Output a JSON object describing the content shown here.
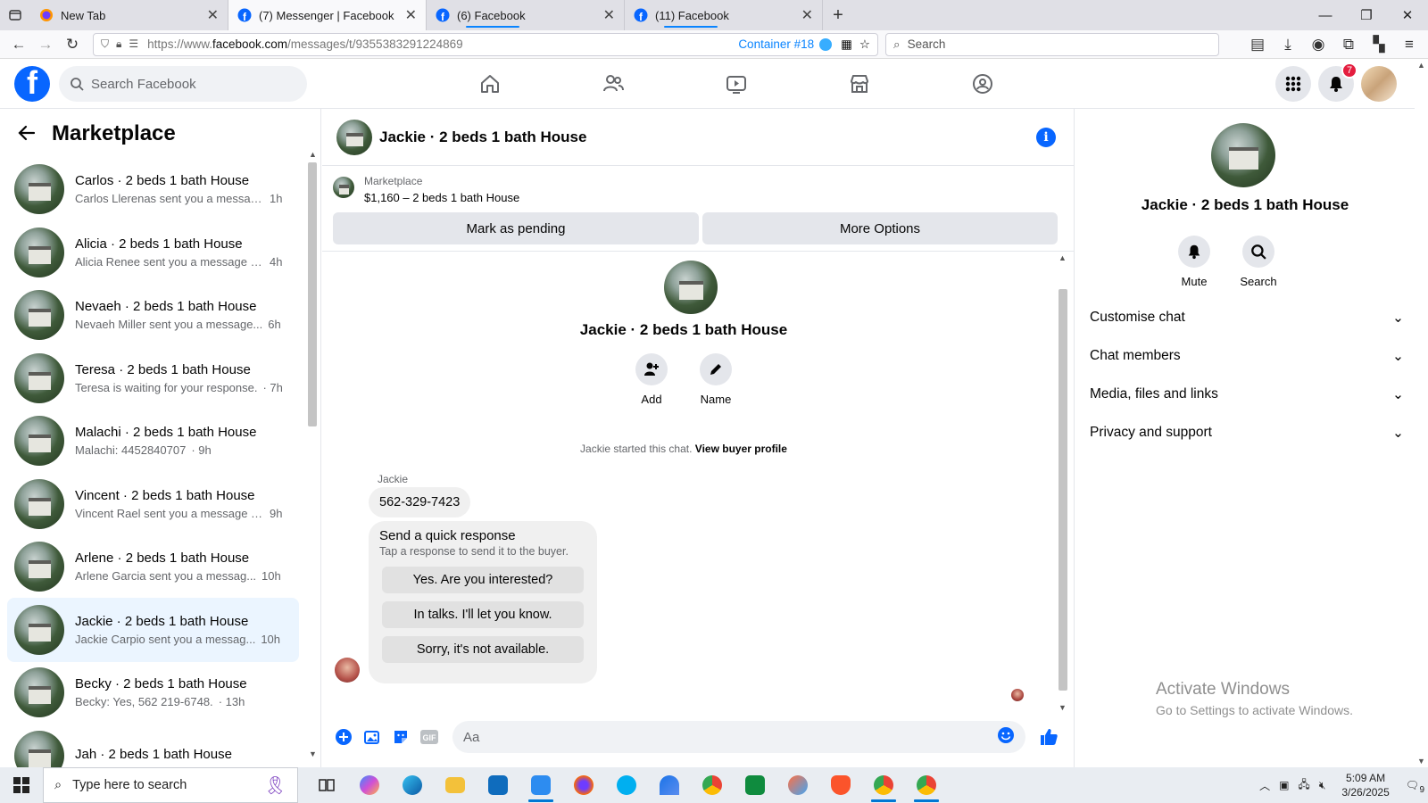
{
  "browser": {
    "tabs": [
      {
        "label": "New Tab",
        "favicon": "firefox"
      },
      {
        "label": "(7) Messenger | Facebook",
        "favicon": "facebook",
        "active": true
      },
      {
        "label": "(6) Facebook",
        "favicon": "facebook"
      },
      {
        "label": "(11) Facebook",
        "favicon": "facebook"
      }
    ],
    "url_prefix": "https://www.",
    "url_domain": "facebook.com",
    "url_path": "/messages/t/9355383291224869",
    "container_label": "Container #18",
    "search_placeholder": "Search"
  },
  "fb": {
    "search_placeholder": "Search Facebook",
    "notifications_count": "7",
    "brand_color": "#0866ff"
  },
  "sidebar": {
    "title": "Marketplace",
    "conversations": [
      {
        "name": "Carlos · 2 beds 1 bath House",
        "preview": "Carlos Llerenas sent you a messag...",
        "time": "1h"
      },
      {
        "name": "Alicia · 2 beds 1 bath House",
        "preview": "Alicia Renee sent you a message a...",
        "time": "4h"
      },
      {
        "name": "Nevaeh · 2 beds 1 bath House",
        "preview": "Nevaeh Miller sent you a message...",
        "time": "6h"
      },
      {
        "name": "Teresa · 2 beds 1 bath House",
        "preview": "Teresa is waiting for your response.",
        "time": "· 7h"
      },
      {
        "name": "Malachi · 2 beds 1 bath House",
        "preview": "Malachi: 4452840707",
        "time": "· 9h"
      },
      {
        "name": "Vincent · 2 beds 1 bath House",
        "preview": "Vincent Rael sent you a message a...",
        "time": "9h"
      },
      {
        "name": "Arlene · 2 beds 1 bath House",
        "preview": "Arlene Garcia sent you a messag...",
        "time": "10h"
      },
      {
        "name": "Jackie · 2 beds 1 bath House",
        "preview": "Jackie Carpio sent you a messag...",
        "time": "10h",
        "selected": true
      },
      {
        "name": "Becky · 2 beds 1 bath House",
        "preview": "Becky: Yes, 562 219-6748.",
        "time": "· 13h"
      },
      {
        "name": "Jah · 2 beds 1 bath House",
        "preview": "",
        "time": ""
      }
    ]
  },
  "chat": {
    "title": "Jackie · 2 beds 1 bath House",
    "listing_category": "Marketplace",
    "listing_price": "$1,160 – 2 beds 1 bath House",
    "mark_pending_label": "Mark as pending",
    "more_options_label": "More Options",
    "center_title": "Jackie · 2 beds 1 bath House",
    "add_label": "Add",
    "name_label": "Name",
    "started_text": "Jackie started this chat.",
    "view_profile_label": "View buyer profile",
    "sender": "Jackie",
    "message": "562-329-7423",
    "quick_title": "Send a quick response",
    "quick_subtitle": "Tap a response to send it to the buyer.",
    "quick_options": [
      "Yes. Are you interested?",
      "In talks. I'll let you know.",
      "Sorry, it's not available."
    ],
    "composer_placeholder": "Aa"
  },
  "details": {
    "title": "Jackie · 2 beds 1 bath House",
    "mute_label": "Mute",
    "search_label": "Search",
    "sections": [
      "Customise chat",
      "Chat members",
      "Media, files and links",
      "Privacy and support"
    ],
    "watermark_title": "Activate Windows",
    "watermark_sub": "Go to Settings to activate Windows."
  },
  "taskbar": {
    "search_placeholder": "Type here to search",
    "time": "5:09 AM",
    "date": "3/26/2025",
    "notif_count": "9"
  }
}
